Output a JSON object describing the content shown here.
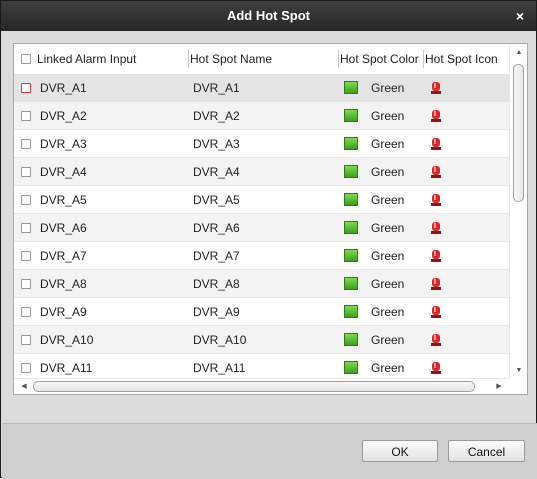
{
  "dialog": {
    "title": "Add Hot Spot",
    "close_label": "×"
  },
  "table": {
    "columns": {
      "linked_alarm_input": "Linked Alarm Input",
      "hot_spot_name": "Hot Spot Name",
      "hot_spot_color": "Hot Spot Color",
      "hot_spot_icon": "Hot Spot Icon"
    },
    "rows": [
      {
        "input": "DVR_A1",
        "name": "DVR_A1",
        "color": "Green"
      },
      {
        "input": "DVR_A2",
        "name": "DVR_A2",
        "color": "Green"
      },
      {
        "input": "DVR_A3",
        "name": "DVR_A3",
        "color": "Green"
      },
      {
        "input": "DVR_A4",
        "name": "DVR_A4",
        "color": "Green"
      },
      {
        "input": "DVR_A5",
        "name": "DVR_A5",
        "color": "Green"
      },
      {
        "input": "DVR_A6",
        "name": "DVR_A6",
        "color": "Green"
      },
      {
        "input": "DVR_A7",
        "name": "DVR_A7",
        "color": "Green"
      },
      {
        "input": "DVR_A8",
        "name": "DVR_A8",
        "color": "Green"
      },
      {
        "input": "DVR_A9",
        "name": "DVR_A9",
        "color": "Green"
      },
      {
        "input": "DVR_A10",
        "name": "DVR_A10",
        "color": "Green"
      },
      {
        "input": "DVR_A11",
        "name": "DVR_A11",
        "color": "Green"
      }
    ],
    "swatch_color": "#4caf2a",
    "hot_spot_icon_name": "alarm-siren-icon"
  },
  "buttons": {
    "ok": "OK",
    "cancel": "Cancel"
  }
}
